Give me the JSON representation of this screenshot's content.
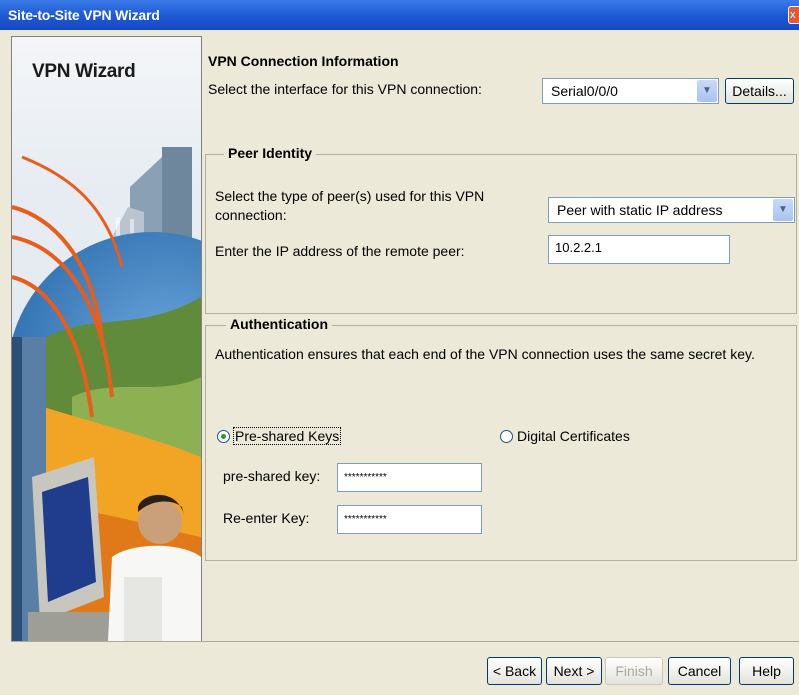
{
  "window": {
    "title": "Site-to-Site VPN Wizard",
    "close_glyph": "x"
  },
  "sidebar": {
    "title": "VPN Wizard"
  },
  "connection": {
    "heading": "VPN Connection Information",
    "interface_label": "Select the interface for this VPN connection:",
    "interface_value": "Serial0/0/0",
    "details_button": "Details..."
  },
  "peer": {
    "legend": "Peer Identity",
    "type_label_line1": "Select the type of peer(s) used for this VPN",
    "type_label_line2": "connection:",
    "type_value": "Peer with static IP address",
    "ip_label": "Enter the IP address of the remote peer:",
    "ip_value": "10.2.2.1"
  },
  "auth": {
    "legend": "Authentication",
    "description": "Authentication ensures that each end of the VPN connection uses the same secret key.",
    "psk_option": "Pre-shared Keys",
    "cert_option": "Digital Certificates",
    "selected": "Pre-shared Keys",
    "psk_label": "pre-shared key:",
    "psk_value": "***********",
    "reenter_label": "Re-enter Key:",
    "reenter_value": "***********"
  },
  "footer": {
    "back": "< Back",
    "next": "Next >",
    "finish": "Finish",
    "cancel": "Cancel",
    "help": "Help"
  }
}
